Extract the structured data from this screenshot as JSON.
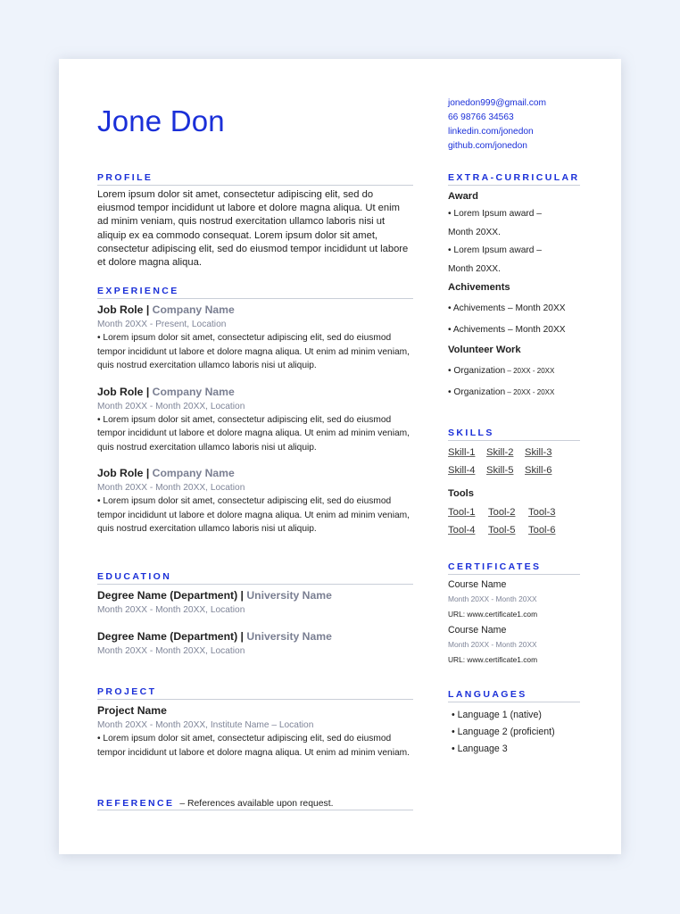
{
  "header": {
    "name": "Jone Don"
  },
  "contact": {
    "email": "jonedon999@gmail.com",
    "phone": "66 98766 34563",
    "linkedin": "linkedin.com/jonedon",
    "github": "github.com/jonedon"
  },
  "profile": {
    "heading": "PROFILE",
    "text": "Lorem ipsum dolor sit amet, consectetur adipiscing elit, sed do eiusmod tempor incididunt ut labore et dolore magna aliqua. Ut enim ad minim veniam, quis nostrud exercitation ullamco laboris nisi ut aliquip ex ea commodo consequat. Lorem ipsum dolor sit amet, consectetur adipiscing elit, sed do eiusmod tempor incididunt ut labore et dolore magna aliqua."
  },
  "experience": {
    "heading": "EXPERIENCE",
    "items": [
      {
        "role": "Job Role",
        "separator": "|",
        "company": "Company Name",
        "meta": "Month 20XX - Present, Location",
        "bullet": "• Lorem ipsum dolor sit amet, consectetur adipiscing elit, sed do eiusmod tempor incididunt ut labore et dolore magna aliqua. Ut enim ad minim veniam, quis nostrud exercitation ullamco laboris nisi ut aliquip."
      },
      {
        "role": "Job Role",
        "separator": "|",
        "company": "Company Name",
        "meta": "Month 20XX - Month 20XX, Location",
        "bullet": "• Lorem ipsum dolor sit amet, consectetur adipiscing elit, sed do eiusmod tempor incididunt ut labore et dolore magna aliqua. Ut enim ad minim veniam, quis nostrud exercitation ullamco laboris nisi ut aliquip."
      },
      {
        "role": "Job Role",
        "separator": "|",
        "company": "Company Name",
        "meta": "Month 20XX - Month 20XX, Location",
        "bullet": "• Lorem ipsum dolor sit amet, consectetur adipiscing elit, sed do eiusmod tempor incididunt ut labore et dolore magna aliqua. Ut enim ad minim veniam, quis nostrud exercitation ullamco laboris nisi ut aliquip."
      }
    ]
  },
  "education": {
    "heading": "EDUCATION",
    "items": [
      {
        "degree": "Degree Name (Department)",
        "separator": "|",
        "school": "University Name",
        "meta": "Month 20XX - Month 20XX, Location"
      },
      {
        "degree": "Degree Name (Department)",
        "separator": "|",
        "school": "University Name",
        "meta": "Month 20XX - Month 20XX, Location"
      }
    ]
  },
  "project": {
    "heading": "PROJECT",
    "name": "Project Name",
    "meta": "Month 20XX - Month 20XX, Institute Name – Location",
    "bullet": "•  Lorem ipsum dolor sit amet, consectetur adipiscing elit, sed do eiusmod tempor incididunt ut labore et dolore magna aliqua. Ut enim ad minim veniam."
  },
  "reference": {
    "heading": "REFERENCE",
    "text": "– References available upon request."
  },
  "extracurricular": {
    "heading": "EXTRA-CURRICULAR",
    "award_title": "Award",
    "awards": [
      "• Lorem Ipsum award –",
      "Month 20XX.",
      "• Lorem Ipsum award –",
      "Month 20XX."
    ],
    "achievements_title": "Achivements",
    "achievements": [
      "• Achivements – Month 20XX",
      "• Achivements – Month 20XX"
    ],
    "volunteer_title": "Volunteer Work",
    "volunteer": [
      {
        "org": "• Organization",
        "dates": " – 20XX - 20XX"
      },
      {
        "org": "• Organization",
        "dates": " – 20XX - 20XX"
      }
    ]
  },
  "skills": {
    "heading": "SKILLS",
    "items": [
      "Skill-1",
      "Skill-2",
      "Skill-3",
      "Skill-4",
      "Skill-5",
      "Skill-6"
    ],
    "tools_title": "Tools",
    "tools": [
      "Tool-1",
      "Tool-2",
      "Tool-3",
      "Tool-4",
      "Tool-5",
      "Tool-6"
    ]
  },
  "certificates": {
    "heading": "CERTIFICATES",
    "items": [
      {
        "name": "Course Name",
        "meta": "Month 20XX - Month 20XX",
        "url": "URL: www.certificate1.com"
      },
      {
        "name": "Course Name",
        "meta": "Month 20XX - Month 20XX",
        "url": "URL: www.certificate1.com"
      }
    ]
  },
  "languages": {
    "heading": "LANGUAGES",
    "items": [
      "•  Language 1 (native)",
      "•  Language 2 (proficient)",
      "•  Language 3"
    ]
  }
}
